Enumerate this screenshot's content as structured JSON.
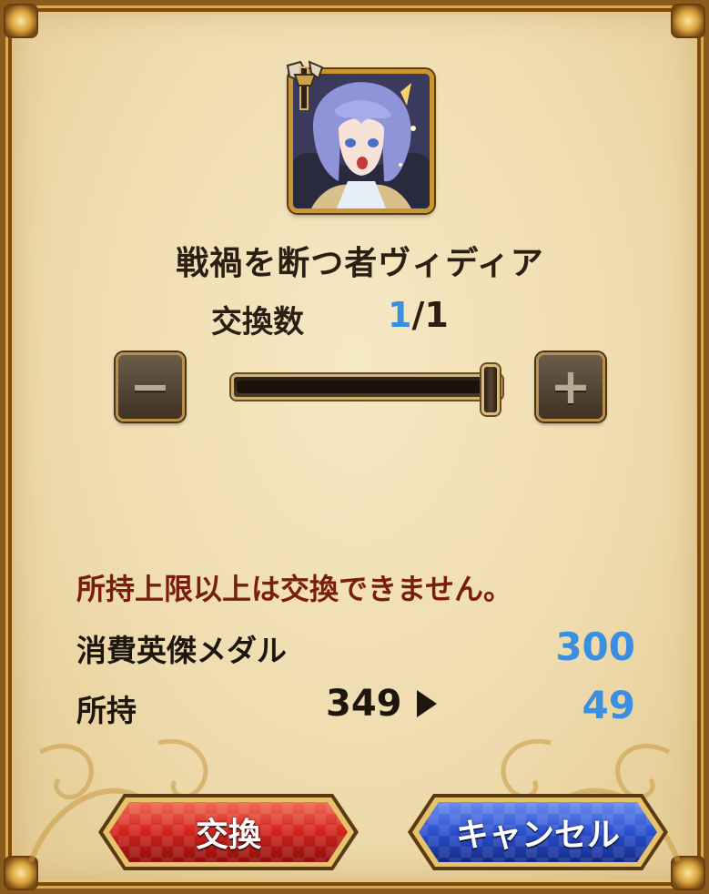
{
  "unit": {
    "name": "戦禍を断つ者ヴィディア",
    "portrait_icon": "character-portrait"
  },
  "exchange_count": {
    "label": "交換数",
    "current": "1",
    "separator": "/1",
    "current_value": 1,
    "max_value": 1
  },
  "stepper": {
    "minus_icon": "minus-icon",
    "plus_icon": "plus-icon",
    "minus_glyph": "−",
    "plus_glyph": "+",
    "slider_fraction": 1.0
  },
  "warning": "所持上限以上は交換できません。",
  "cost": {
    "label": "消費英傑メダル",
    "value": "300"
  },
  "owned": {
    "label": "所持",
    "before": "349",
    "after": "49"
  },
  "buttons": {
    "exchange_label": "交換",
    "cancel_label": "キャンセル"
  },
  "colors": {
    "accent_blue": "#3a8fe0",
    "warning_red": "#7a1c10",
    "exchange_button": "#d0221c",
    "cancel_button": "#2a4fcf"
  }
}
